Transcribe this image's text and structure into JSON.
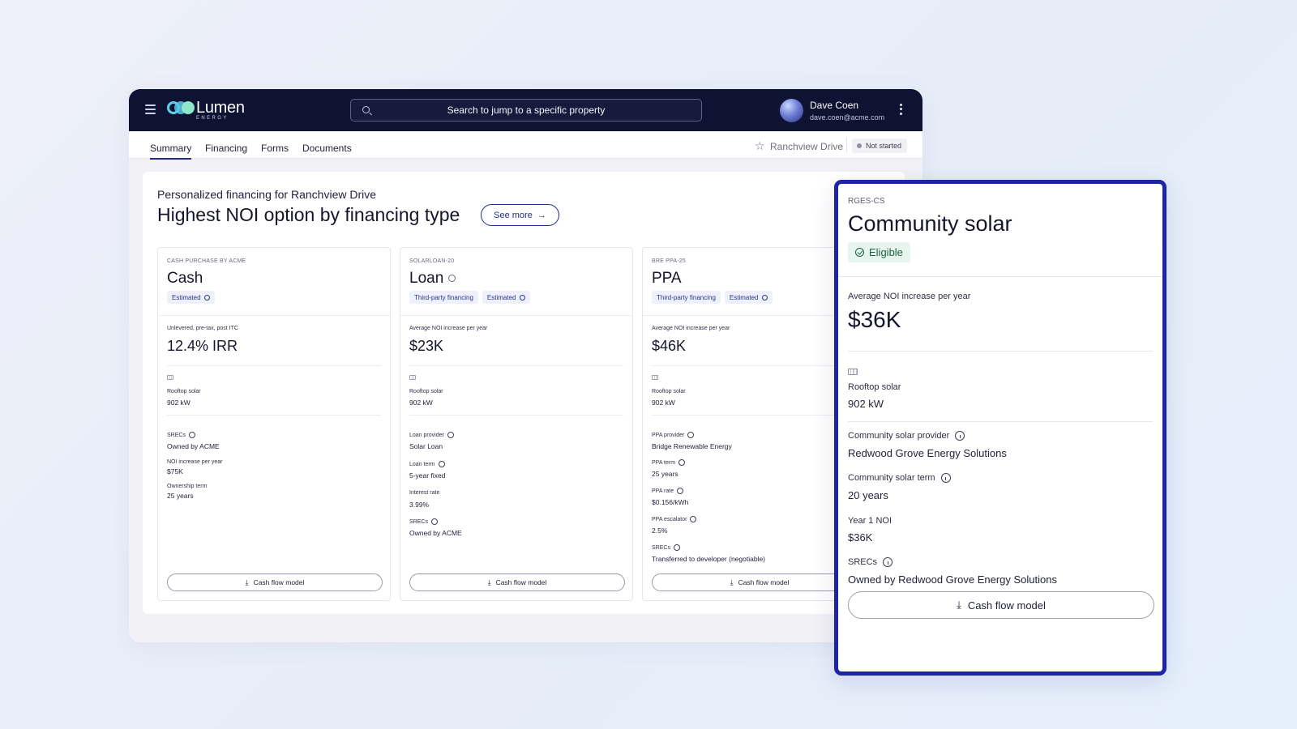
{
  "header": {
    "logo_name": "Lumen",
    "logo_sub": "ENERGY",
    "search_placeholder": "Search to jump to a specific property",
    "user_name": "Dave Coen",
    "user_email": "dave.coen@acme.com"
  },
  "subnav": {
    "tabs": [
      {
        "label": "Summary",
        "active": true
      },
      {
        "label": "Financing"
      },
      {
        "label": "Forms"
      },
      {
        "label": "Documents"
      }
    ],
    "property_name": "Ranchview Drive",
    "status": "Not started"
  },
  "main": {
    "subtitle": "Personalized financing for Ranchview Drive",
    "title": "Highest NOI option by financing type",
    "see_more": "See more",
    "cards": [
      {
        "eyebrow": "CASH PURCHASE BY ACME",
        "title": "Cash",
        "tags": [
          "Estimated"
        ],
        "metric_label": "Unlevered, pre-tax, post ITC",
        "metric_value": "12.4% IRR",
        "system_label": "Rooftop solar",
        "system_value": "902 kW",
        "details": [
          {
            "label": "SRECs",
            "value": "Owned by ACME"
          },
          {
            "label": "NOI increase per year",
            "value": "$75K"
          },
          {
            "label": "Ownership term",
            "value": "25 years"
          }
        ],
        "button": "Cash flow model"
      },
      {
        "eyebrow": "SOLARLOAN-20",
        "title": "Loan",
        "tags": [
          "Third-party financing",
          "Estimated"
        ],
        "metric_label": "Average NOI increase per year",
        "metric_value": "$23K",
        "system_label": "Rooftop solar",
        "system_value": "902 kW",
        "details": [
          {
            "label": "Loan provider",
            "value": "Solar Loan"
          },
          {
            "label": "Loan term",
            "value": "5-year fixed"
          },
          {
            "label": "Interest rate",
            "value": "3.99%"
          },
          {
            "label": "SRECs",
            "value": "Owned by ACME"
          }
        ],
        "button": "Cash flow model"
      },
      {
        "eyebrow": "BRE PPA-25",
        "title": "PPA",
        "tags": [
          "Third-party financing",
          "Estimated"
        ],
        "metric_label": "Average NOI increase per year",
        "metric_value": "$46K",
        "system_label": "Rooftop solar",
        "system_value": "902 kW",
        "details": [
          {
            "label": "PPA provider",
            "value": "Bridge Renewable Energy"
          },
          {
            "label": "PPA term",
            "value": "25 years"
          },
          {
            "label": "PPA rate",
            "value": "$0.156/kWh"
          },
          {
            "label": "PPA escalator",
            "value": "2.5%"
          },
          {
            "label": "SRECs",
            "value": "Transferred to developer (negotiable)"
          }
        ],
        "button": "Cash flow model"
      }
    ]
  },
  "highlight": {
    "eyebrow": "RGES-CS",
    "title": "Community solar",
    "badge": "Eligible",
    "metric_label": "Average NOI increase per year",
    "metric_value": "$36K",
    "system_label": "Rooftop solar",
    "system_value": "902 kW",
    "details": [
      {
        "label": "Community solar provider",
        "value": "Redwood Grove Energy Solutions"
      },
      {
        "label": "Community solar term",
        "value": "20 years"
      },
      {
        "label": "Year 1 NOI",
        "value": "$36K"
      },
      {
        "label": "SRECs",
        "value": "Owned by Redwood Grove Energy Solutions"
      }
    ],
    "button": "Cash flow model"
  },
  "colors": {
    "nav_bg": "#0e1333",
    "accent": "#1f2a8a",
    "highlight_border": "#1e24a8",
    "eligible_bg": "#e7f5ee"
  }
}
